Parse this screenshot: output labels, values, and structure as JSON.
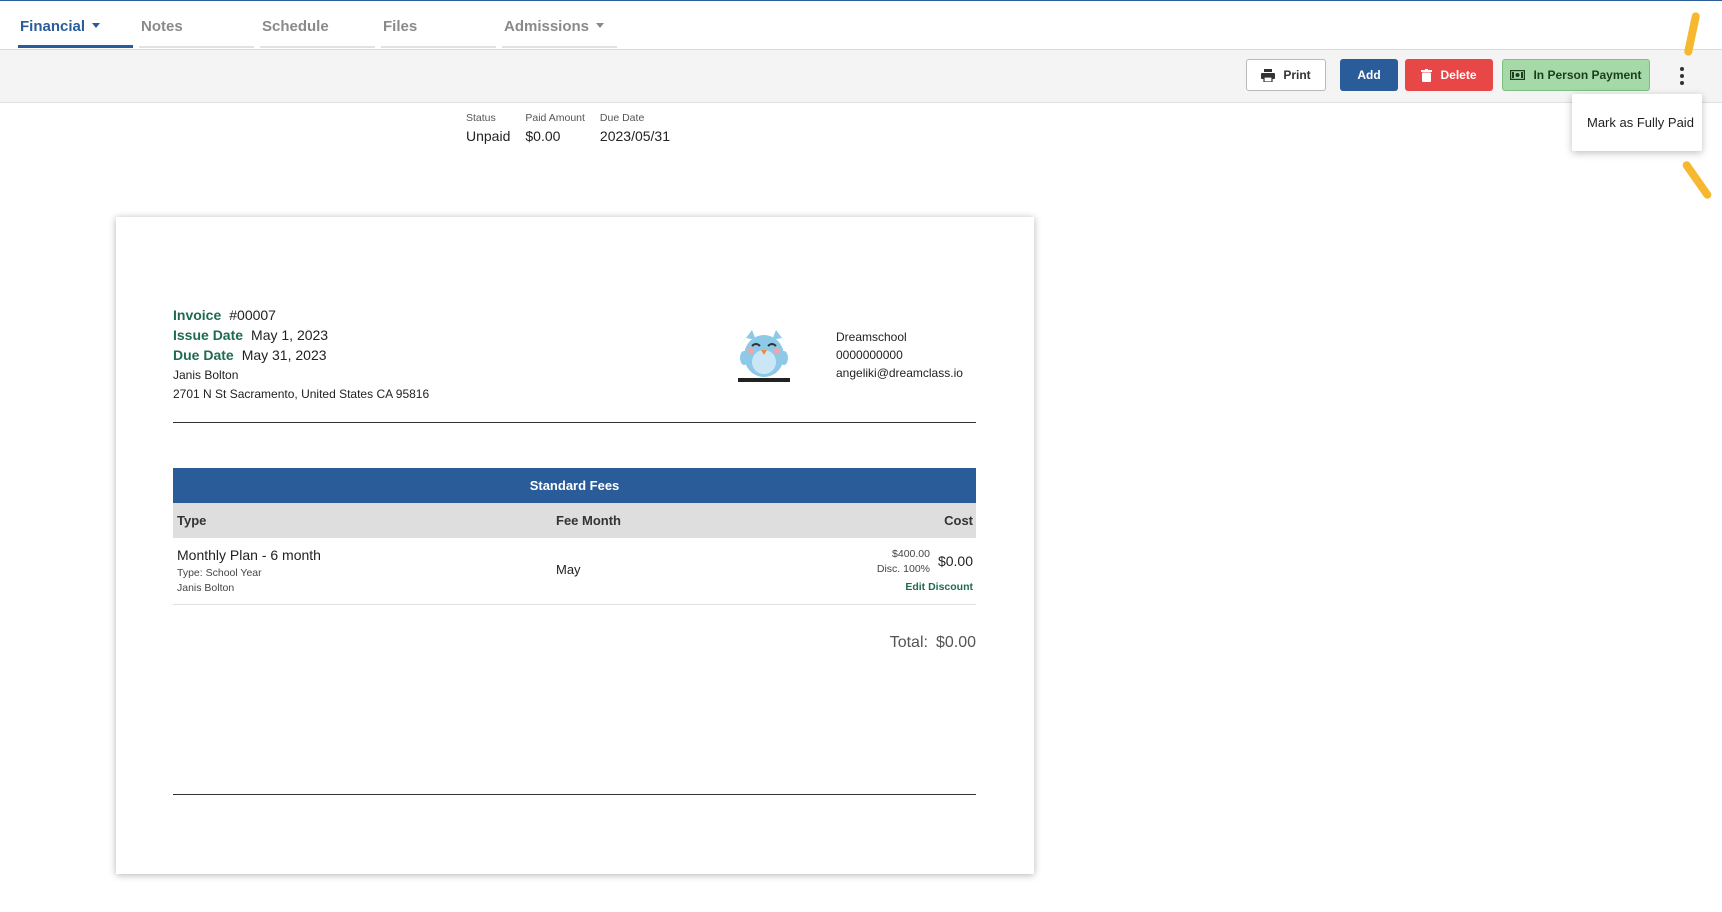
{
  "tabs": [
    {
      "label": "Financial",
      "has_caret": true,
      "active": true
    },
    {
      "label": "Notes"
    },
    {
      "label": "Schedule"
    },
    {
      "label": "Files"
    },
    {
      "label": "Admissions",
      "has_caret": true
    }
  ],
  "toolbar": {
    "print_label": "Print",
    "add_label": "Add",
    "delete_label": "Delete",
    "in_person_label": "In Person Payment"
  },
  "menu": {
    "items": [
      {
        "label": "Mark as Fully Paid"
      }
    ]
  },
  "summary": [
    {
      "label": "Status",
      "value": "Unpaid"
    },
    {
      "label": "Paid Amount",
      "value": "$0.00"
    },
    {
      "label": "Due Date",
      "value": "2023/05/31"
    }
  ],
  "invoice": {
    "invoice_label": "Invoice",
    "invoice_number": "#00007",
    "issue_label": "Issue Date",
    "issue_date": "May 1, 2023",
    "due_label": "Due Date",
    "due_date": "May 31, 2023",
    "bill_to_name": "Janis Bolton",
    "bill_to_address": "2701 N St Sacramento, United States CA 95816",
    "school_name": "Dreamschool",
    "school_phone": "0000000000",
    "school_email": "angeliki@dreamclass.io",
    "table_title": "Standard Fees",
    "columns": {
      "type": "Type",
      "fee_month": "Fee Month",
      "cost": "Cost"
    },
    "rows": [
      {
        "name": "Monthly Plan - 6 month",
        "type_line": "Type: School Year",
        "student": "Janis Bolton",
        "fee_month": "May",
        "original": "$400.00",
        "discount": "Disc. 100%",
        "cost": "$0.00",
        "edit_label": "Edit Discount"
      }
    ],
    "total_label": "Total:",
    "total_value": "$0.00"
  },
  "colors": {
    "primary": "#2b5c9a",
    "delete": "#e84747",
    "in_person": "#a5d9a7",
    "label_green": "#1f6b4f",
    "annotation_arrow": "#f5b82e"
  },
  "icons": [
    "printer-icon",
    "trash-icon",
    "cash-icon",
    "more-vertical-icon",
    "owl-logo"
  ]
}
